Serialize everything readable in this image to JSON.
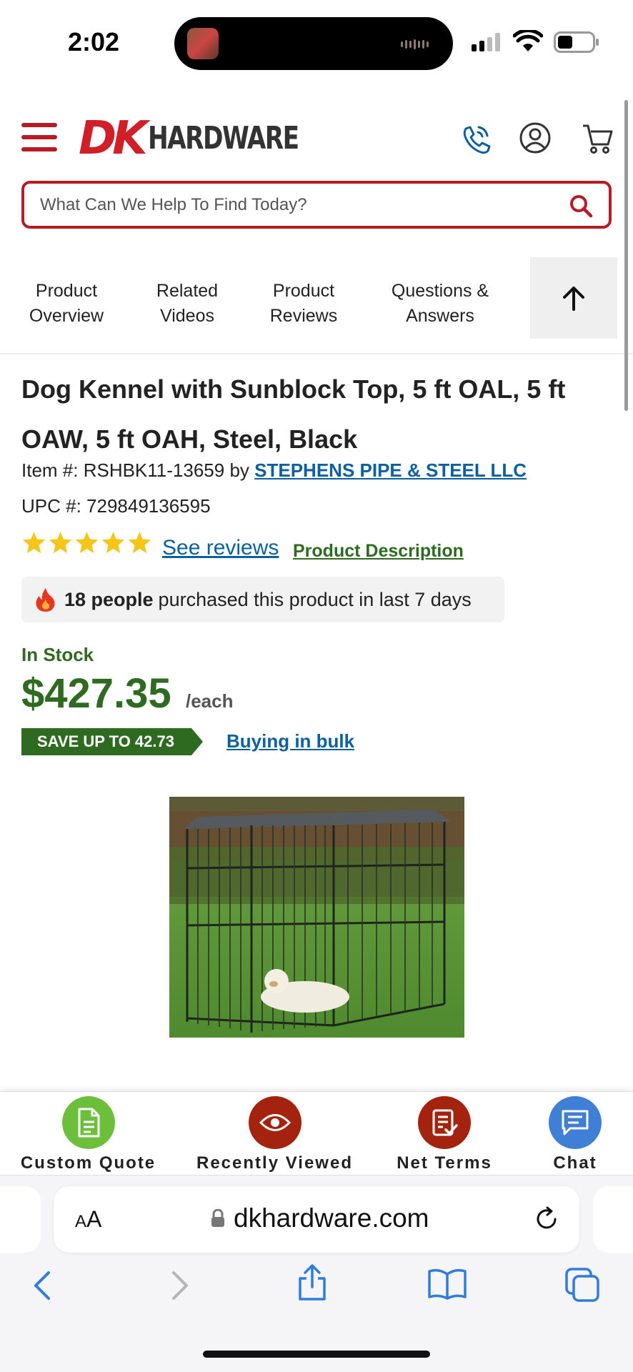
{
  "status": {
    "time": "2:02"
  },
  "header": {
    "logo_dk": "DK",
    "logo_word": "HARDWARE",
    "brand_color": "#b71c25"
  },
  "search": {
    "placeholder": "What Can We Help To Find Today?"
  },
  "tabs": [
    {
      "line1": "Product",
      "line2": "Overview"
    },
    {
      "line1": "Related",
      "line2": "Videos"
    },
    {
      "line1": "Product",
      "line2": "Reviews"
    },
    {
      "line1": "Questions &",
      "line2": "Answers"
    }
  ],
  "product": {
    "title": "Dog Kennel with Sunblock Top, 5 ft OAL, 5 ft OAW, 5 ft OAH, Steel, Black",
    "item_label": "Item #: RSHBK11-13659 by",
    "brand": "STEPHENS PIPE & STEEL LLC",
    "upc": "UPC #: 729849136595",
    "rating_stars": 5,
    "reviews_link": "See reviews",
    "description_link": "Product Description",
    "purchase_count": "18 people",
    "purchase_text": "purchased this product in last 7 days",
    "stock": "In Stock",
    "price": "$427.35",
    "unit": "/each",
    "save_badge": "SAVE UP TO 42.73",
    "bulk_link": "Buying in bulk",
    "price_color": "#2e6b20"
  },
  "actions": [
    {
      "label": "Custom Quote",
      "icon": "document-icon",
      "color": "#6bbf3a"
    },
    {
      "label": "Recently Viewed",
      "icon": "eye-icon",
      "color": "#a3230f"
    },
    {
      "label": "Net Terms",
      "icon": "invoice-check-icon",
      "color": "#a3230f"
    },
    {
      "label": "Chat",
      "icon": "chat-icon",
      "color": "#3f7fd6"
    }
  ],
  "browser": {
    "text_size_label_small": "A",
    "text_size_label_large": "A",
    "url": "dkhardware.com"
  }
}
